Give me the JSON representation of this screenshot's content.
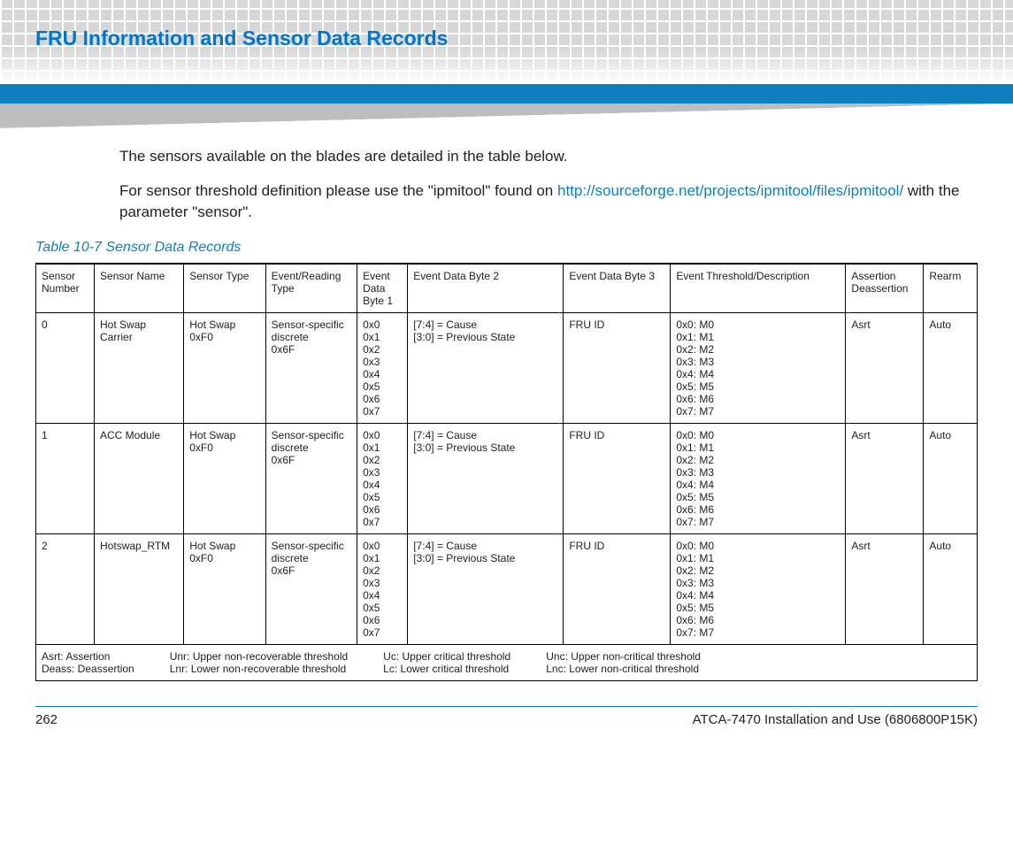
{
  "header": {
    "title": "FRU Information and Sensor Data Records"
  },
  "intro": {
    "p1": "The sensors available on the blades are detailed in the table below.",
    "p2_pre": "For sensor threshold definition please use the \"ipmitool\" found on ",
    "p2_link": "http://sourceforge.net/projects/ipmitool/files/ipmitool/",
    "p2_post": " with the parameter \"sensor\"."
  },
  "table": {
    "caption": "Table 10-7 Sensor Data Records",
    "headers": {
      "c0": "Sensor Number",
      "c1": "Sensor Name",
      "c2": "Sensor Type",
      "c3": "Event/Reading Type",
      "c4": "Event Data Byte 1",
      "c5": "Event Data Byte 2",
      "c6": "Event Data Byte 3",
      "c7": "Event Threshold/Description",
      "c8": "Assertion Deassertion",
      "c9": "Rearm"
    },
    "rows": [
      {
        "num": "0",
        "name": "Hot Swap Carrier",
        "type": "Hot Swap\n0xF0",
        "ert": "Sensor-specific discrete\n0x6F",
        "edb1": "0x0\n0x1\n0x2\n0x3\n0x4\n0x5\n0x6\n0x7",
        "edb2": "[7:4] = Cause\n[3:0] = Previous State",
        "edb3": "FRU ID",
        "thresh": "0x0: M0\n0x1: M1\n0x2: M2\n0x3: M3\n0x4: M4\n0x5: M5\n0x6: M6\n0x7: M7",
        "assert": "Asrt",
        "rearm": "Auto"
      },
      {
        "num": "1",
        "name": "ACC Module",
        "type": "Hot Swap\n0xF0",
        "ert": "Sensor-specific discrete\n0x6F",
        "edb1": "0x0\n0x1\n0x2\n0x3\n0x4\n0x5\n0x6\n0x7",
        "edb2": "[7:4] = Cause\n[3:0] = Previous State",
        "edb3": "FRU ID",
        "thresh": "0x0: M0\n0x1: M1\n0x2: M2\n0x3: M3\n0x4: M4\n0x5: M5\n0x6: M6\n0x7: M7",
        "assert": "Asrt",
        "rearm": "Auto"
      },
      {
        "num": "2",
        "name": "Hotswap_RTM",
        "type": "Hot Swap\n0xF0",
        "ert": "Sensor-specific discrete\n0x6F",
        "edb1": "0x0\n0x1\n0x2\n0x3\n0x4\n0x5\n0x6\n0x7",
        "edb2": "[7:4] = Cause\n[3:0] = Previous State",
        "edb3": "FRU ID",
        "thresh": "0x0: M0\n0x1: M1\n0x2: M2\n0x3: M3\n0x4: M4\n0x5: M5\n0x6: M6\n0x7: M7",
        "assert": "Asrt",
        "rearm": "Auto"
      }
    ],
    "legend": {
      "col1": "Asrt: Assertion\nDeass: Deassertion",
      "col2": "Unr: Upper non-recoverable threshold\nLnr: Lower non-recoverable threshold",
      "col3": "Uc: Upper critical threshold\nLc: Lower critical threshold",
      "col4": "Unc: Upper non-critical threshold\nLnc: Lower non-critical threshold"
    }
  },
  "footer": {
    "page": "262",
    "doc": "ATCA-7470 Installation and Use (6806800P15K)"
  }
}
